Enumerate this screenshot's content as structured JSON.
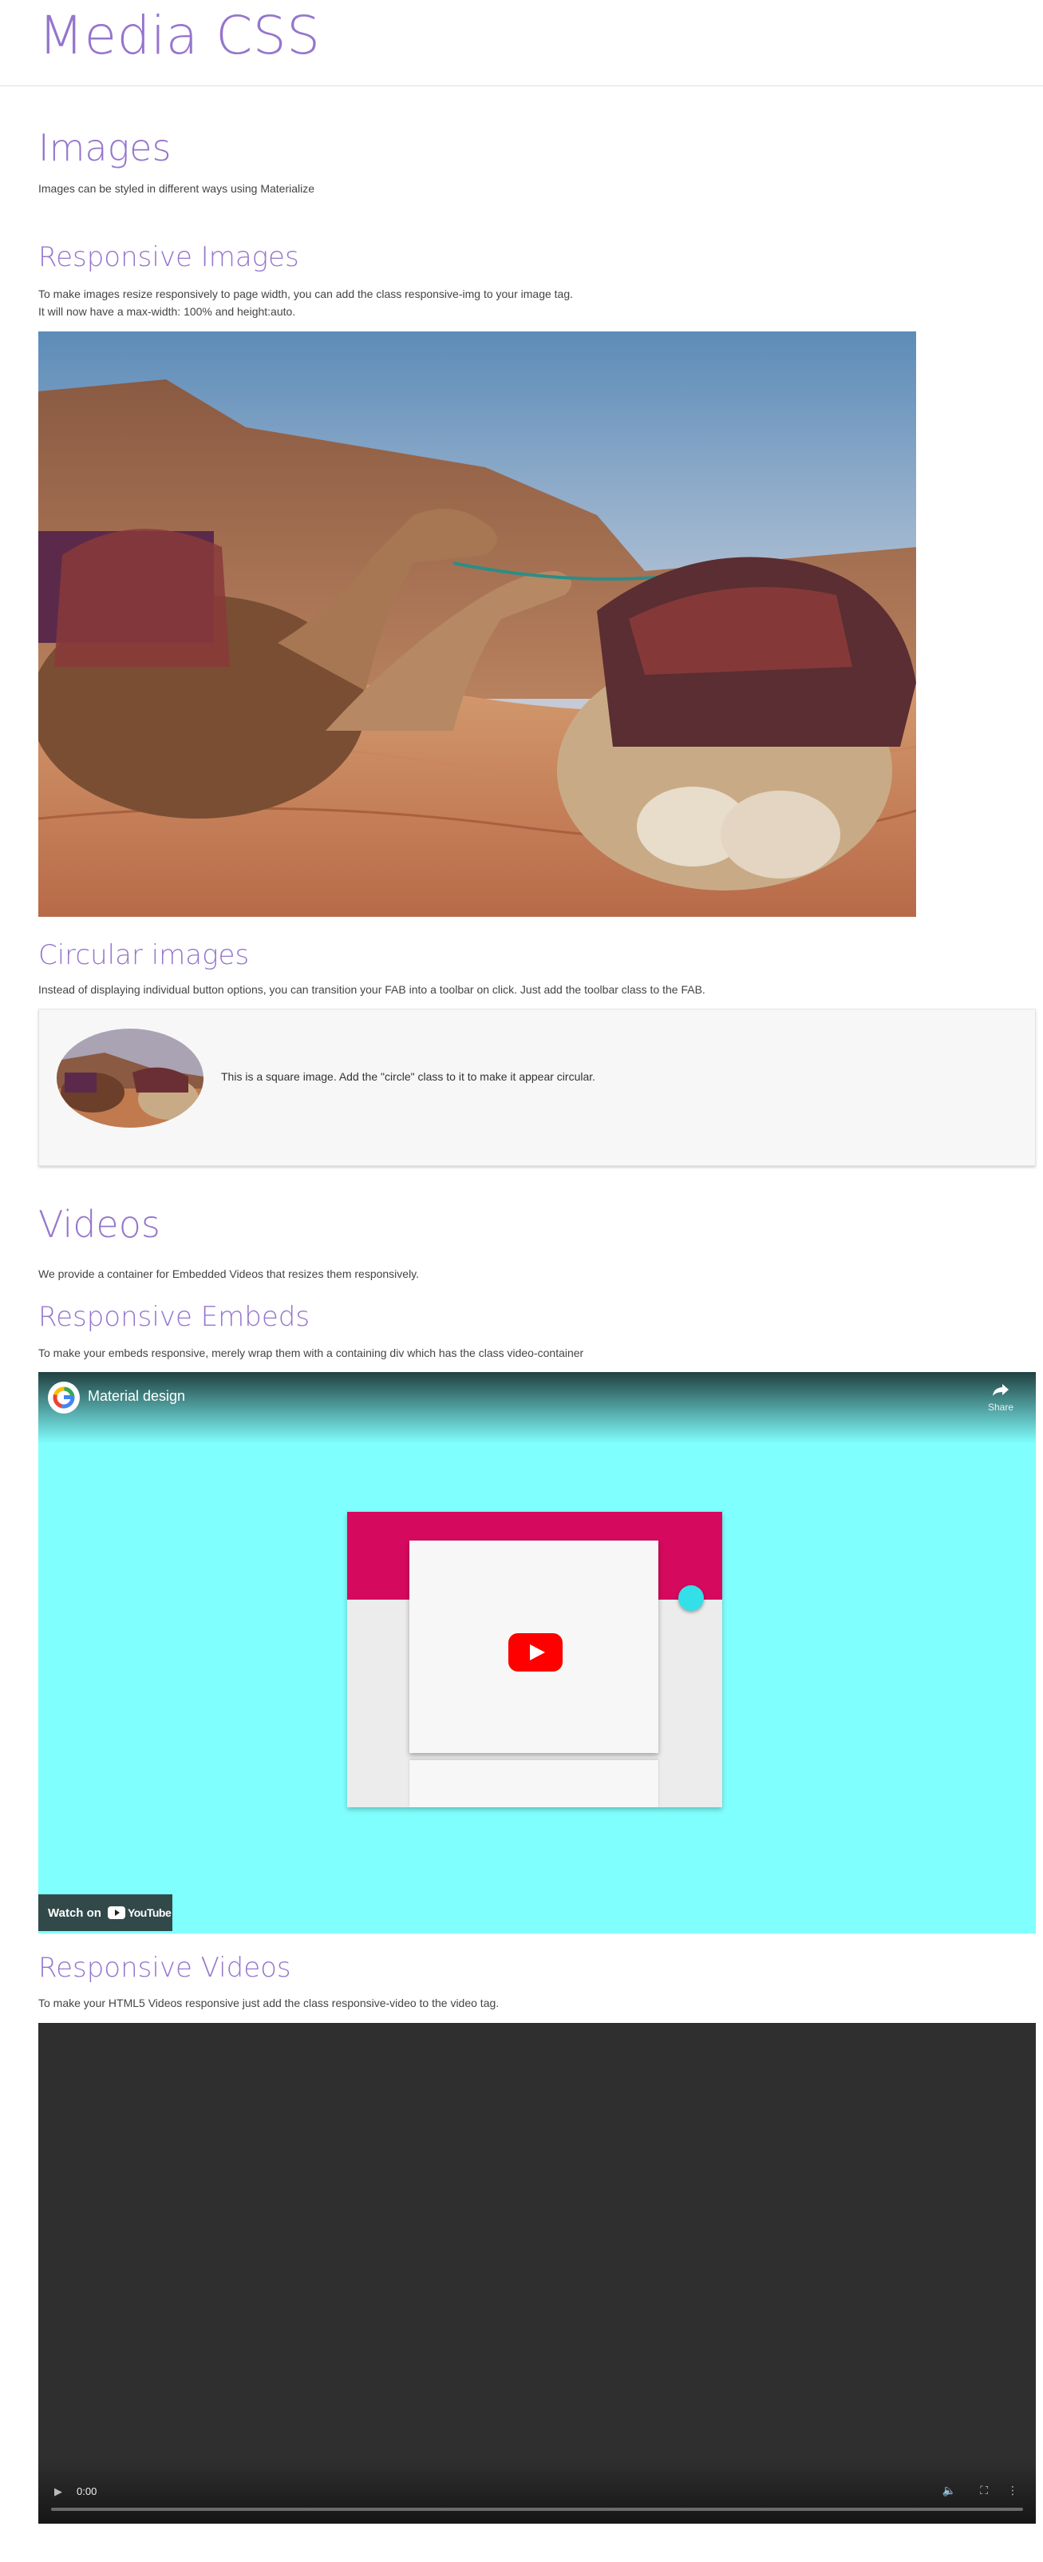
{
  "page": {
    "title": "Media CSS"
  },
  "images": {
    "heading": "Images",
    "description": "Images can be styled in different ways using Materialize"
  },
  "responsive_images": {
    "heading": "Responsive Images",
    "line1": "To make images resize responsively to page width, you can add the class responsive-img to your image tag.",
    "line2": "It will now have a max-width: 100% and height:auto."
  },
  "circular_images": {
    "heading": "Circular images",
    "description": "Instead of displaying individual button options, you can transition your FAB into a toolbar on click. Just add the toolbar class to the FAB.",
    "card_text": "This is a square image. Add the \"circle\" class to it to make it appear circular."
  },
  "videos": {
    "heading": "Videos",
    "description": "We provide a container for Embedded Videos that resizes them responsively."
  },
  "responsive_embeds": {
    "heading": "Responsive Embeds",
    "description": "To make your embeds responsive, merely wrap them with a containing div which has the class video-container",
    "player": {
      "title": "Material design",
      "share_label": "Share",
      "watch_on": "Watch on",
      "youtube_label": "YouTube"
    }
  },
  "responsive_videos": {
    "heading": "Responsive Videos",
    "description": "To make your HTML5 Videos responsive just add the class responsive-video to the video tag.",
    "player": {
      "time": "0:00",
      "progress": 0
    }
  },
  "colors": {
    "accent": "#9575cd",
    "embed_background": "#80ffff",
    "toolbar_pink": "#d50a5e",
    "fab_cyan": "#34e0e8",
    "video_background": "#2f2f2f"
  }
}
